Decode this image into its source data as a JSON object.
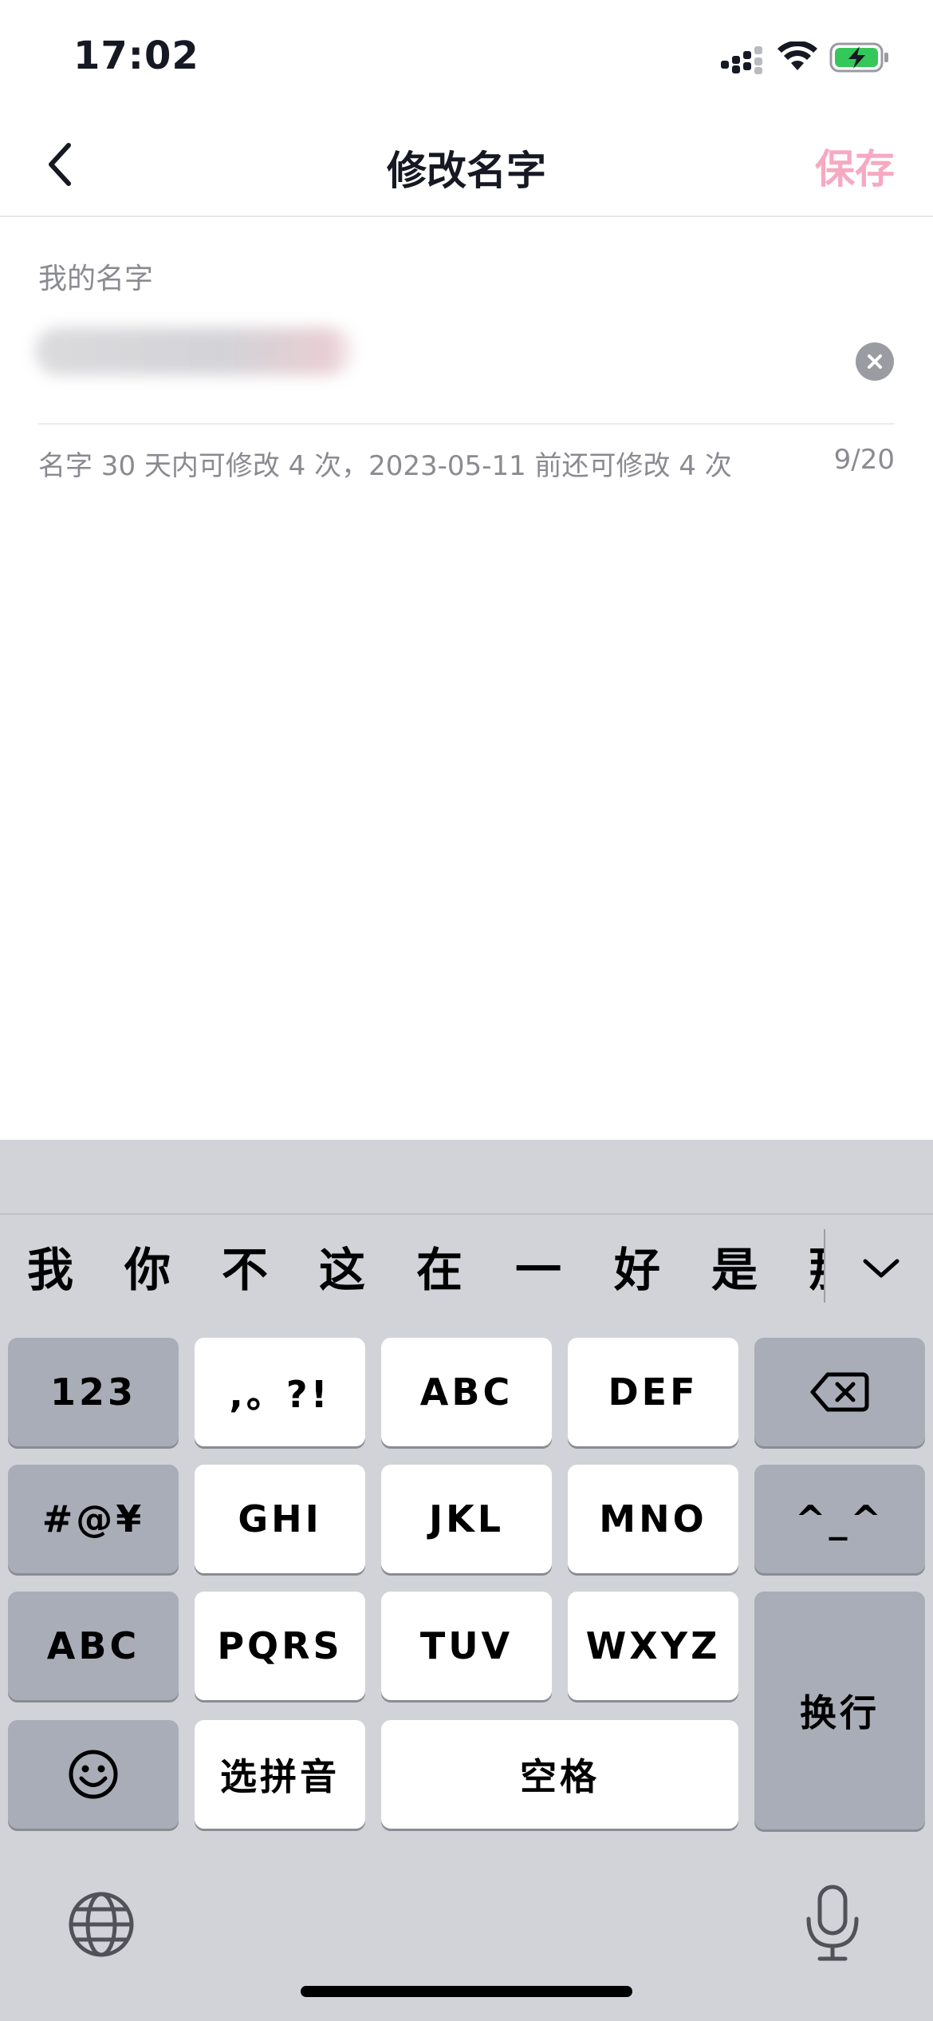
{
  "status_bar": {
    "time": "17:02"
  },
  "nav": {
    "title": "修改名字",
    "save_label": "保存",
    "save_color": "#f6a9c1"
  },
  "form": {
    "label": "我的名字",
    "hint": "名字 30 天内可修改 4 次，2023-05-11 前还可修改 4 次",
    "char_count": "9/20"
  },
  "keyboard": {
    "candidates": [
      "我",
      "你",
      "不",
      "这",
      "在",
      "一",
      "好",
      "是",
      "那"
    ],
    "keys": {
      "num": "123",
      "punct": ",。?!",
      "abc_key": "ABC",
      "def": "DEF",
      "symbols": "#@¥",
      "ghi": "GHI",
      "jkl": "JKL",
      "mno": "MNO",
      "kaomoji": "^_^",
      "abc_mode": "ABC",
      "pqrs": "PQRS",
      "tuv": "TUV",
      "wxyz": "WXYZ",
      "return": "换行",
      "select_pinyin": "选拼音",
      "space": "空格"
    },
    "icons": [
      "backspace-icon",
      "emoji-icon",
      "globe-icon",
      "microphone-icon",
      "chevron-down-icon"
    ]
  }
}
